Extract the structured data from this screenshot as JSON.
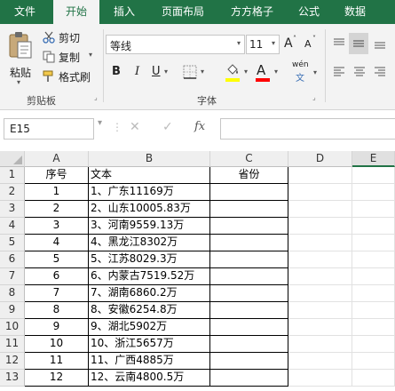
{
  "tabs": [
    "文件",
    "开始",
    "插入",
    "页面布局",
    "方方格子",
    "公式",
    "数据"
  ],
  "clipboard": {
    "paste": "粘贴",
    "cut": "剪切",
    "copy": "复制",
    "format_painter": "格式刷",
    "group": "剪贴板"
  },
  "font": {
    "name": "等线",
    "size": "11",
    "bold": "B",
    "italic": "I",
    "underline": "U",
    "grow": "A",
    "shrink": "A",
    "wen": "wén",
    "wen_char": "文",
    "group": "字体"
  },
  "colors": {
    "ribbon_green": "#217346",
    "highlight": "#ffff00",
    "font_color": "#ff0000"
  },
  "formula_bar": {
    "namebox": "E15",
    "fx": "fx",
    "value": ""
  },
  "sheet": {
    "columns": [
      "A",
      "B",
      "C",
      "D",
      "E"
    ],
    "rows": [
      "1",
      "2",
      "3",
      "4",
      "5",
      "6",
      "7",
      "8",
      "9",
      "10",
      "11",
      "12",
      "13"
    ],
    "header": {
      "a": "序号",
      "b": "文本",
      "c": "省份"
    },
    "data": [
      {
        "a": "1",
        "b": "1、广东11169万",
        "c": ""
      },
      {
        "a": "2",
        "b": "2、山东10005.83万",
        "c": ""
      },
      {
        "a": "3",
        "b": "3、河南9559.13万",
        "c": ""
      },
      {
        "a": "4",
        "b": "4、黑龙江8302万",
        "c": ""
      },
      {
        "a": "5",
        "b": "5、江苏8029.3万",
        "c": ""
      },
      {
        "a": "6",
        "b": "6、内蒙古7519.52万",
        "c": ""
      },
      {
        "a": "7",
        "b": "7、湖南6860.2万",
        "c": ""
      },
      {
        "a": "8",
        "b": "8、安徽6254.8万",
        "c": ""
      },
      {
        "a": "9",
        "b": "9、湖北5902万",
        "c": ""
      },
      {
        "a": "10",
        "b": "10、浙江5657万",
        "c": ""
      },
      {
        "a": "11",
        "b": "11、广西4885万",
        "c": ""
      },
      {
        "a": "12",
        "b": "12、云南4800.5万",
        "c": ""
      }
    ]
  }
}
